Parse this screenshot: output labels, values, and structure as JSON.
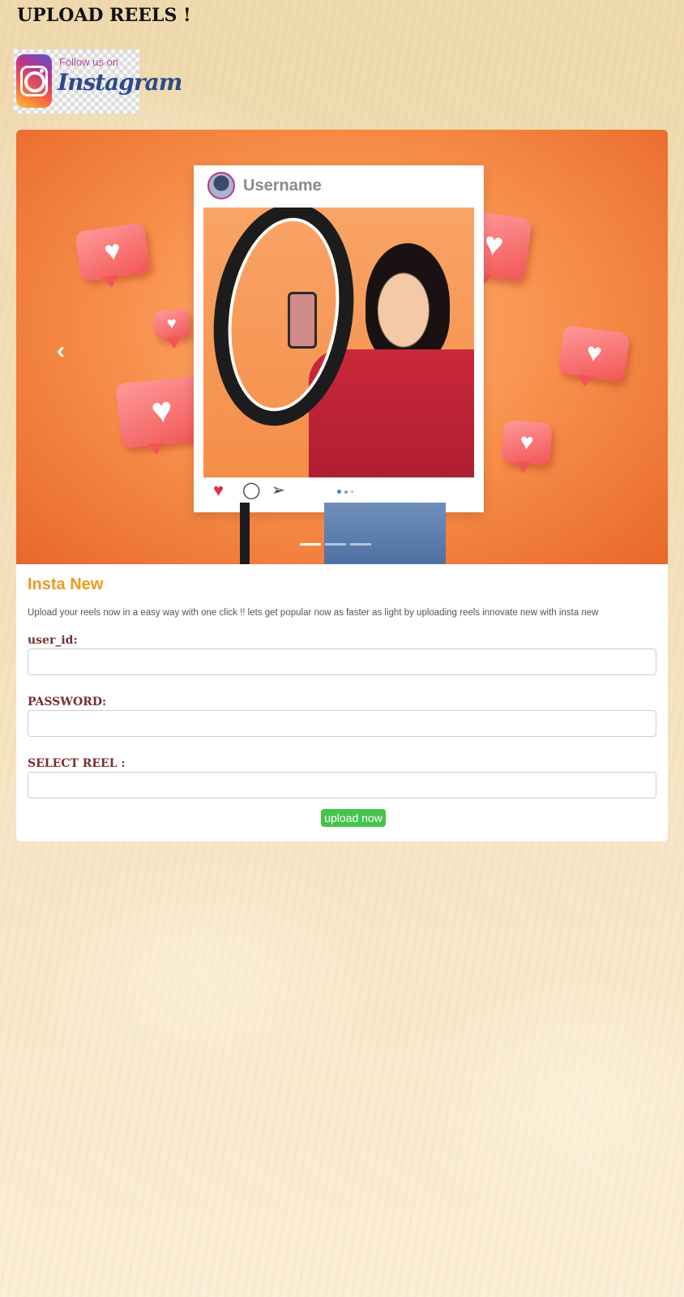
{
  "page": {
    "title": "UPLOAD REELS !"
  },
  "instagram_badge": {
    "follow_text": "Follow us on",
    "brand_text": "Instagram"
  },
  "hero": {
    "post_username": "Username",
    "prev_arrow": "‹",
    "slide_count": 3,
    "active_slide": 1,
    "colors": {
      "background": "#f9924e",
      "heart_bubble": "#f25555"
    },
    "icons": [
      "heart-icon",
      "comment-icon",
      "share-icon"
    ]
  },
  "form": {
    "title": "Insta New",
    "description": "Upload your reels now in a easy way with one click !! lets get popular now as faster as light by uploading reels innovate new with insta new",
    "user_id_label": "user_id:",
    "user_id_value": "",
    "password_label": "PASSWORD:",
    "password_value": "",
    "reel_label": "SELECT REEL :",
    "reel_value": "",
    "submit_label": "upload now",
    "colors": {
      "title": "#ee9a1e",
      "label": "#7a2f2f",
      "submit": "#45c44b"
    }
  }
}
